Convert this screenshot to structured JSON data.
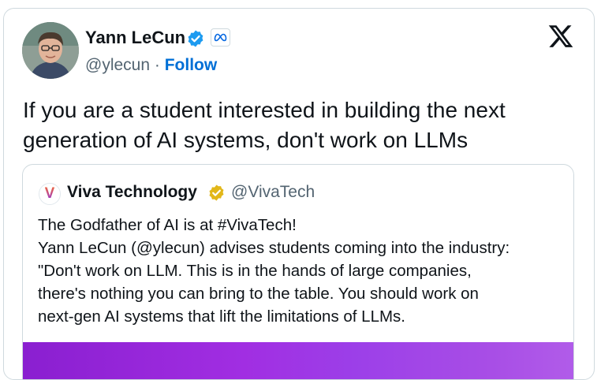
{
  "author": {
    "name": "Yann LeCun",
    "handle": "@ylecun",
    "separator": " · ",
    "follow_label": "Follow"
  },
  "tweet": {
    "text": "If you are a student interested in building the next generation of AI systems, don't work on LLMs"
  },
  "quoted": {
    "logo_letter": "V",
    "name": "Viva Technology",
    "handle": "@VivaTech",
    "lines": [
      "The Godfather of AI is at #VivaTech!",
      "Yann LeCun (@ylecun) advises students coming into the industry:",
      "\"Don't work on LLM. This is in the hands of large companies,",
      "there's nothing you can bring to the table. You should work on",
      "next-gen AI systems that lift the limitations of LLMs."
    ]
  },
  "colors": {
    "verified_blue": "#1d9bf0",
    "verified_gold": "#e2b719",
    "link_blue": "#006fd6",
    "media_purple": "#a12ee2"
  },
  "icons": {
    "verified": "verified-badge-icon",
    "affiliation": "meta-logo-icon",
    "platform": "x-logo-icon"
  }
}
